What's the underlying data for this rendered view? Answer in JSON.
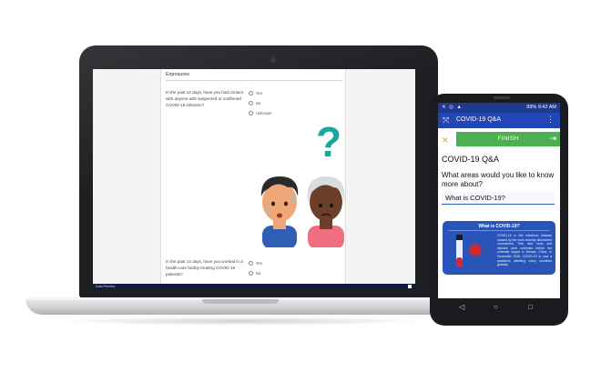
{
  "laptop_form": {
    "section_title": "Exposures",
    "question1": "In the past 14 days, have you had contact with anyone with suspected or confirmed COVID-19 infection?",
    "question1_options": [
      "Yes",
      "No",
      "Unknown"
    ],
    "question2": "In the past 14 days, have you worked in a health-care facility treating COVID-19 patients?",
    "question2_options": [
      "Yes",
      "No"
    ],
    "footer_label": "Data Preview"
  },
  "illustration": {
    "question_mark": "?"
  },
  "phone": {
    "status_right": "99% 9:42 AM",
    "app_title": "COVID-19 Q&A",
    "close_glyph": "✕",
    "finish_label": "FINISH",
    "page_title": "COVID-19 Q&A",
    "question": "What areas would you like to know more about?",
    "answer": "What is COVID-19?",
    "card_title": "What is COVID-19?",
    "card_text": "COVID-19 is the infectious disease caused by the most recently discovered coronavirus. This new virus and disease were unknown before the outbreak began in Wuhan, China, in December 2019. COVID-19 is now a pandemic affecting many countries globally."
  },
  "icons": [
    "close-icon",
    "exit-icon",
    "menu-dots-icon",
    "virus-tube-icon",
    "back-nav-icon",
    "home-nav-icon",
    "recents-nav-icon"
  ],
  "colors": {
    "appbar": "#2246b5",
    "finish": "#4caf50",
    "card": "#2a55b8",
    "accent": "#1aa89e"
  }
}
